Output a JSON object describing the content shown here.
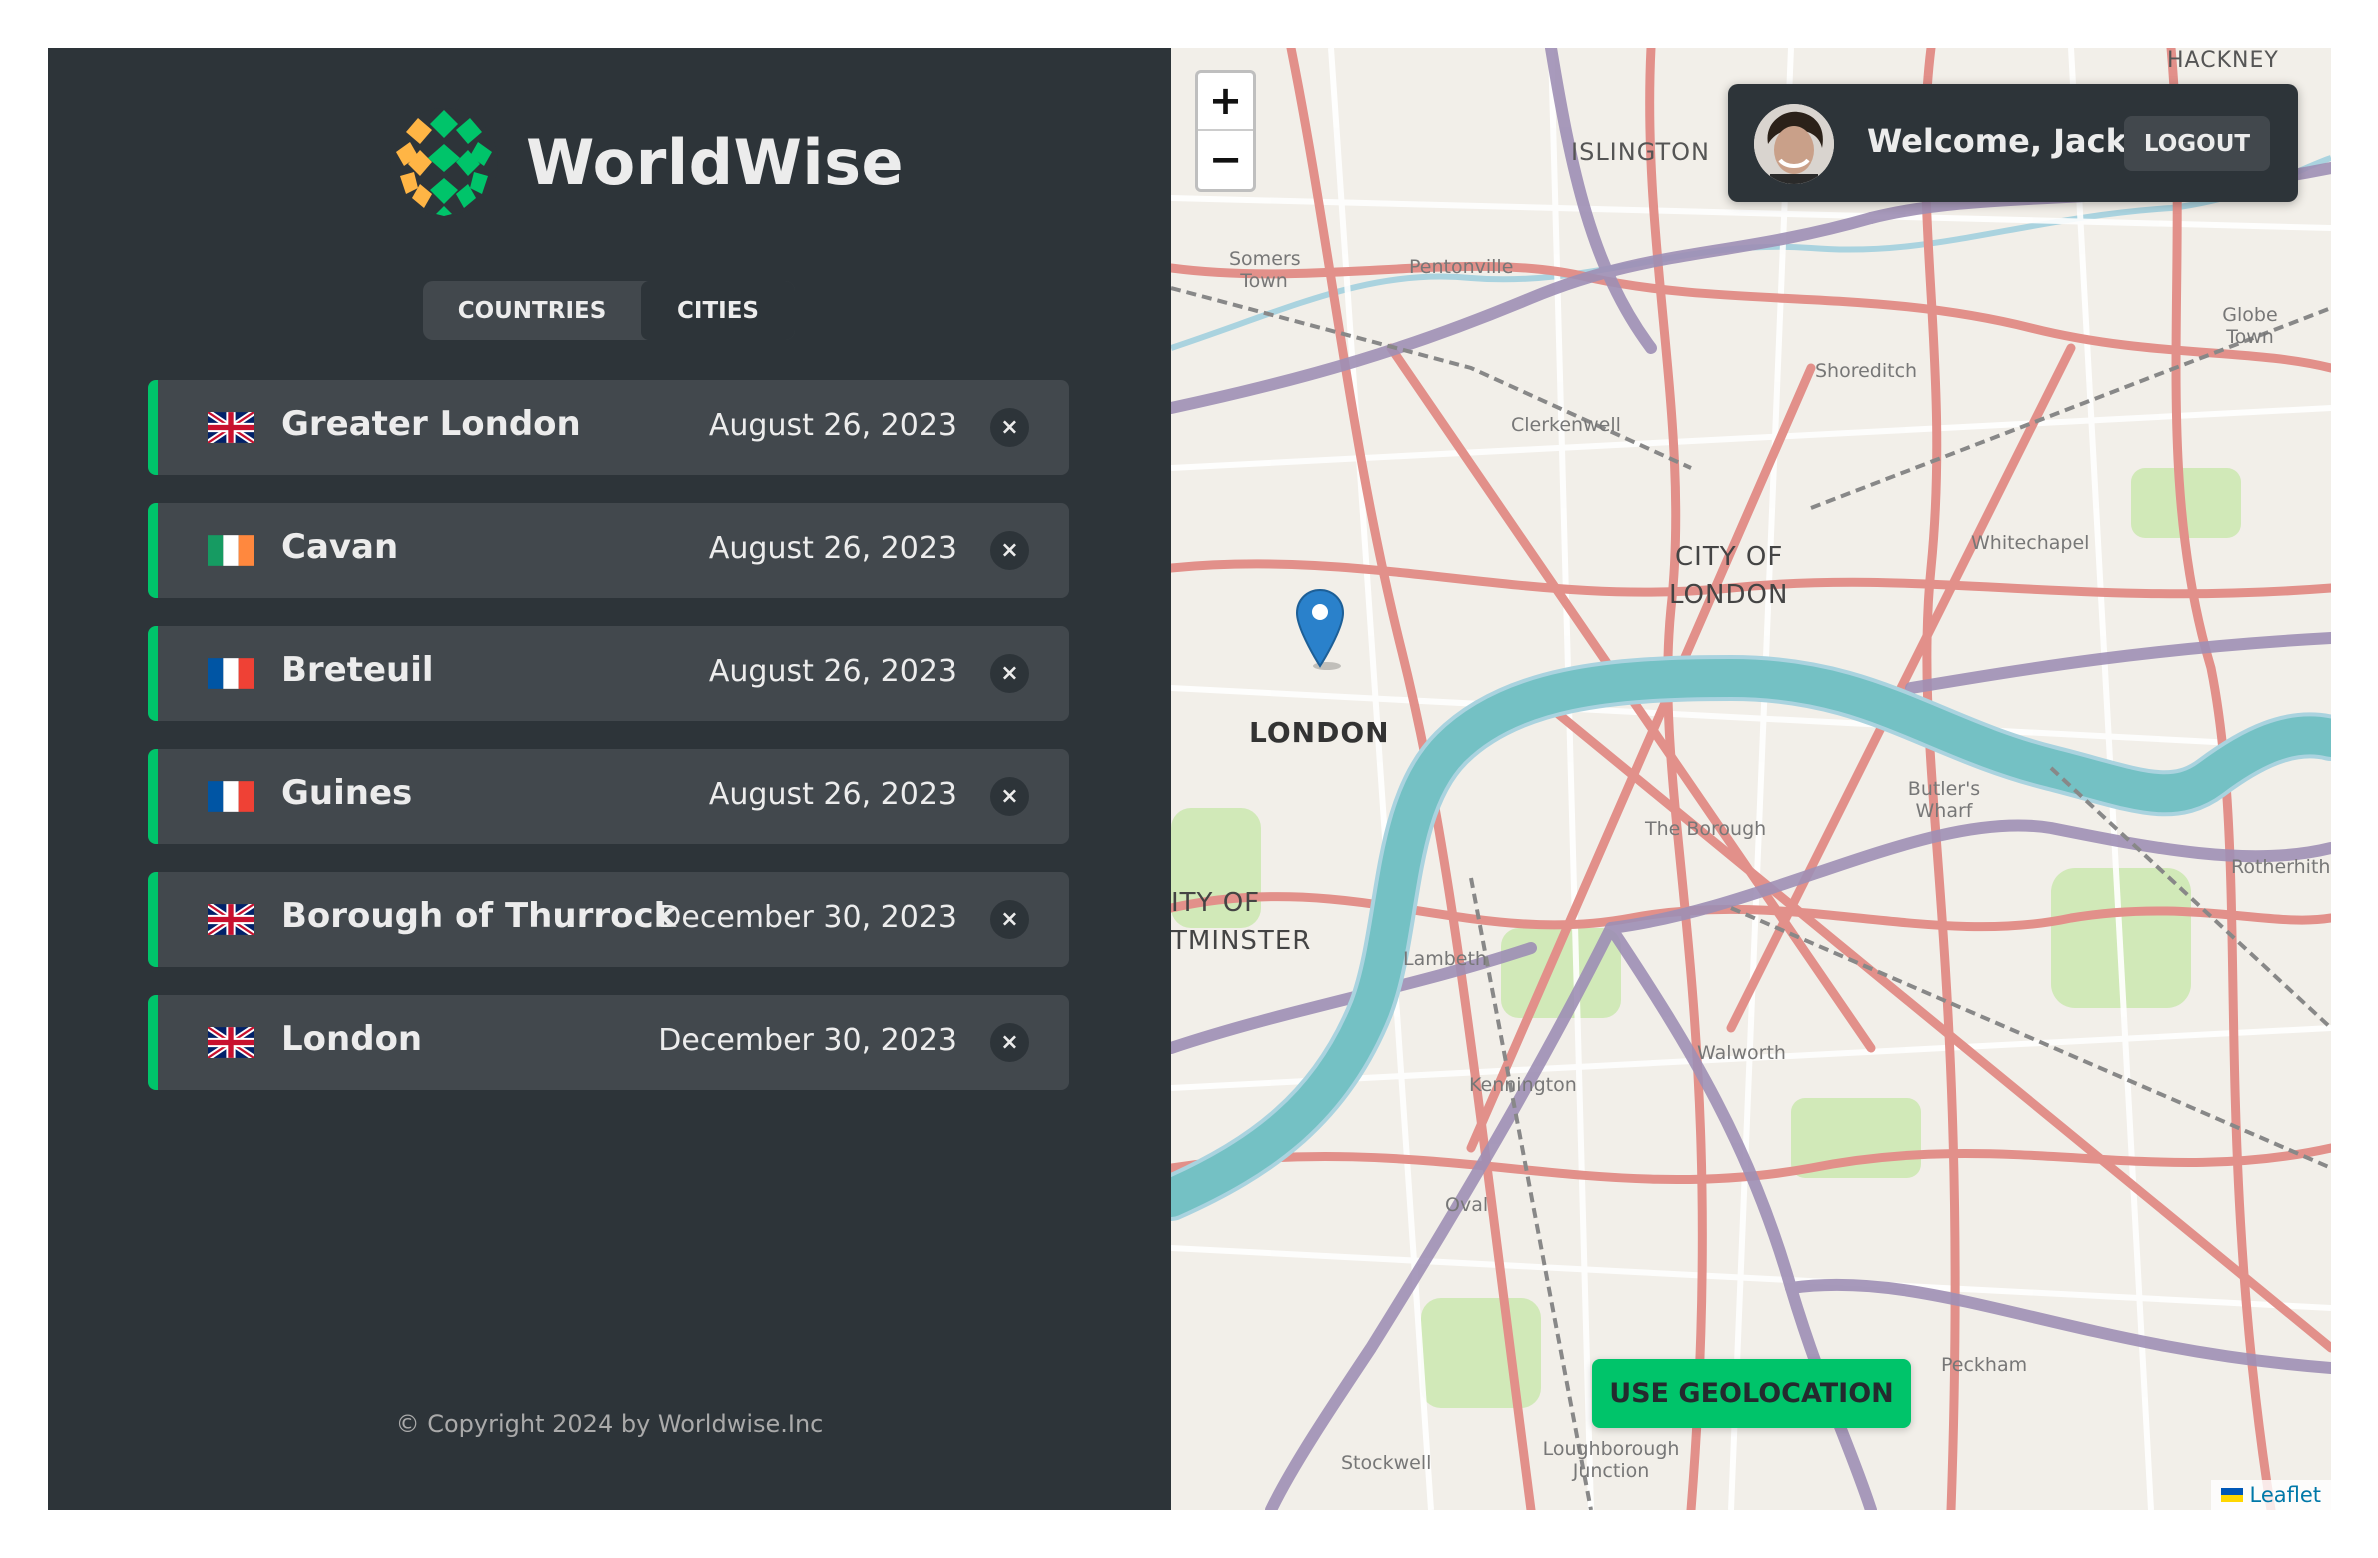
{
  "app": {
    "name": "WorldWise"
  },
  "tabs": [
    {
      "label": "COUNTRIES"
    },
    {
      "label": "CITIES"
    }
  ],
  "cities": [
    {
      "flag": "gb",
      "name": "Greater London",
      "date": "August 26, 2023",
      "delete_label": "×"
    },
    {
      "flag": "ie",
      "name": "Cavan",
      "date": "August 26, 2023",
      "delete_label": "×"
    },
    {
      "flag": "fr",
      "name": "Breteuil",
      "date": "August 26, 2023",
      "delete_label": "×"
    },
    {
      "flag": "fr",
      "name": "Guines",
      "date": "August 26, 2023",
      "delete_label": "×"
    },
    {
      "flag": "gb",
      "name": "Borough of Thurrock",
      "date": "December 30, 2023",
      "delete_label": "×"
    },
    {
      "flag": "gb",
      "name": "London",
      "date": "December 30, 2023",
      "delete_label": "×"
    }
  ],
  "footer": {
    "copyright": "© Copyright 2024 by Worldwise.Inc"
  },
  "map": {
    "zoom_in": "+",
    "zoom_out": "−",
    "geolocation_button": "USE GEOLOCATION",
    "attribution": "Leaflet",
    "labels": {
      "hackney": "HACKNEY",
      "islington": "ISLINGTON",
      "city_of_london_1": "CITY OF",
      "city_of_london_2": "LONDON",
      "london": "LONDON",
      "westminster_1": "ITY OF",
      "westminster_2": "TMINSTER",
      "somers_town": "Somers Town",
      "pentonville": "Pentonville",
      "clerkenwell": "Clerkenwell",
      "shoreditch": "Shoreditch",
      "whitechapel": "Whitechapel",
      "globe_town": "Globe Town",
      "the_borough": "The Borough",
      "butlers_wharf": "Butler's Wharf",
      "lambeth": "Lambeth",
      "kennington": "Kennington",
      "walworth": "Walworth",
      "oval": "Oval",
      "peckham": "Peckham",
      "stockwell": "Stockwell",
      "loughborough": "Loughborough Junction",
      "rotherhithe": "Rotherhith"
    }
  },
  "user": {
    "welcome": "Welcome, Jack",
    "logout_label": "LOGOUT"
  },
  "colors": {
    "sidebar_bg": "#2d3439",
    "item_bg": "#42484d",
    "accent_green": "#00c46a",
    "text_light": "#ececec"
  }
}
